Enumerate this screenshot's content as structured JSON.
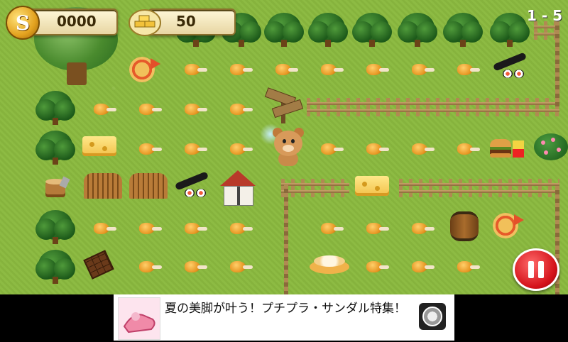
{
  "hud": {
    "coins": "0000",
    "coin_symbol": "S",
    "gold": "50",
    "level": "1 - 5"
  },
  "ad": {
    "text": "夏の美脚が叶う！プチプラ・サンダル特集！"
  },
  "icons": [
    "coin-icon",
    "gold-bars-icon",
    "pause-icon",
    "globe-icon"
  ],
  "colors": {
    "grass": "#8dbb43",
    "pause": "#d4121a",
    "hud_text": "#3a2a08"
  }
}
